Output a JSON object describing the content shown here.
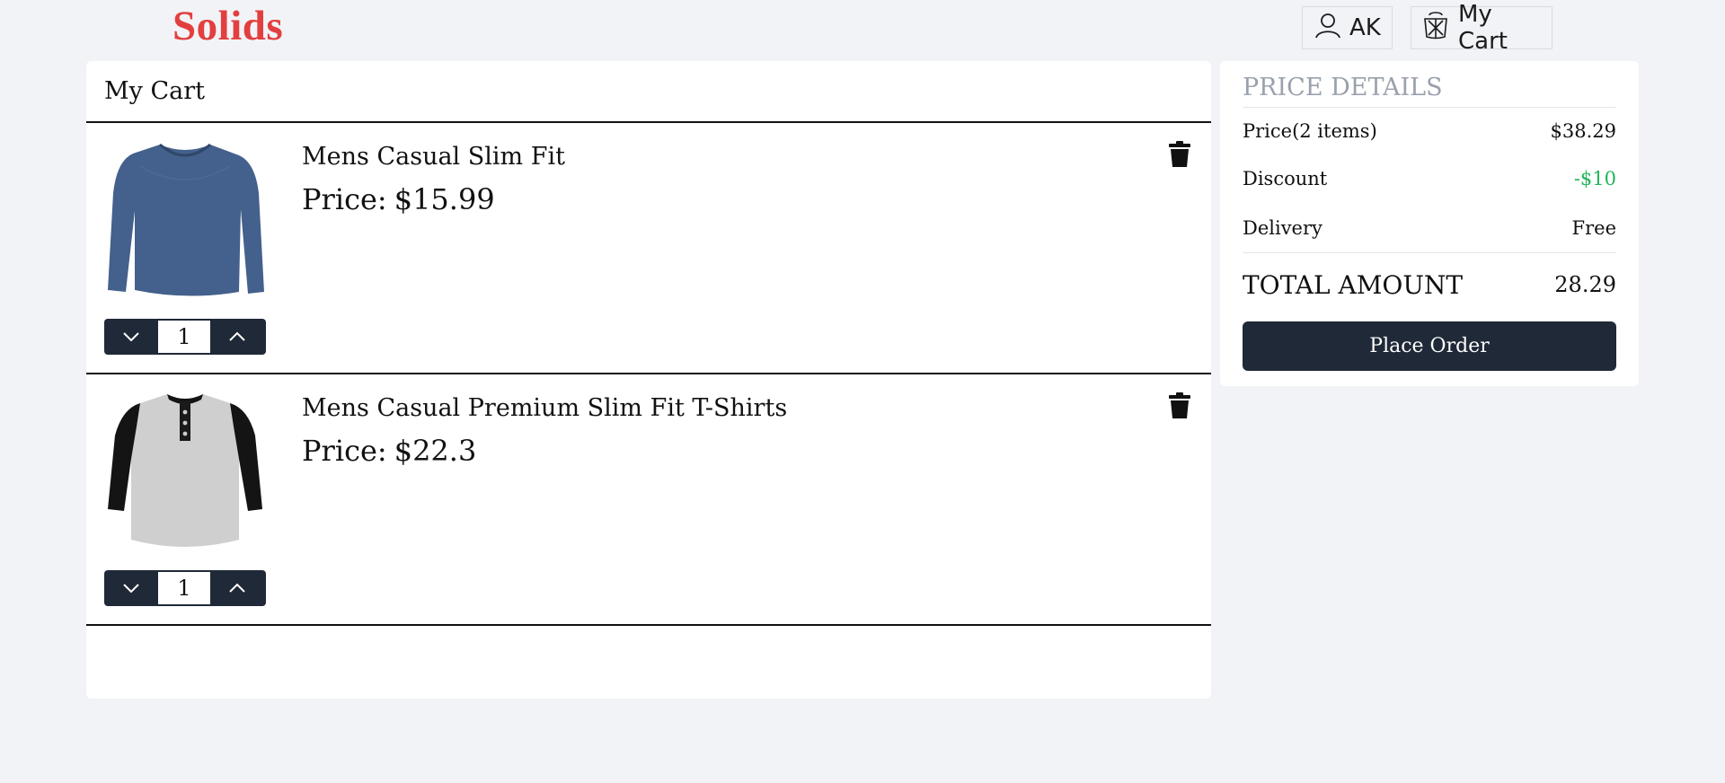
{
  "header": {
    "brand": "Solids",
    "user_label": "AK",
    "cart_label": "My Cart",
    "brand_color": "#e23f3f"
  },
  "cart": {
    "title": "My Cart",
    "items": [
      {
        "name": "Mens Casual Slim Fit",
        "price_label": "Price:",
        "price": "$15.99",
        "quantity": "1",
        "image": "blue long-sleeve v-neck shirt"
      },
      {
        "name": "Mens Casual Premium Slim Fit T-Shirts",
        "price_label": "Price:",
        "price": "$22.3",
        "quantity": "1",
        "image": "grey raglan henley with black sleeves"
      }
    ]
  },
  "price_details": {
    "heading": "PRICE DETAILS",
    "price_label": "Price(2 items)",
    "price_value": "$38.29",
    "discount_label": "Discount",
    "discount_value": "-$10",
    "delivery_label": "Delivery",
    "delivery_value": "Free",
    "total_label": "TOTAL AMOUNT",
    "total_value": "28.29",
    "place_order": "Place Order",
    "button_color": "#1f2937",
    "discount_color": "#22b45a"
  }
}
